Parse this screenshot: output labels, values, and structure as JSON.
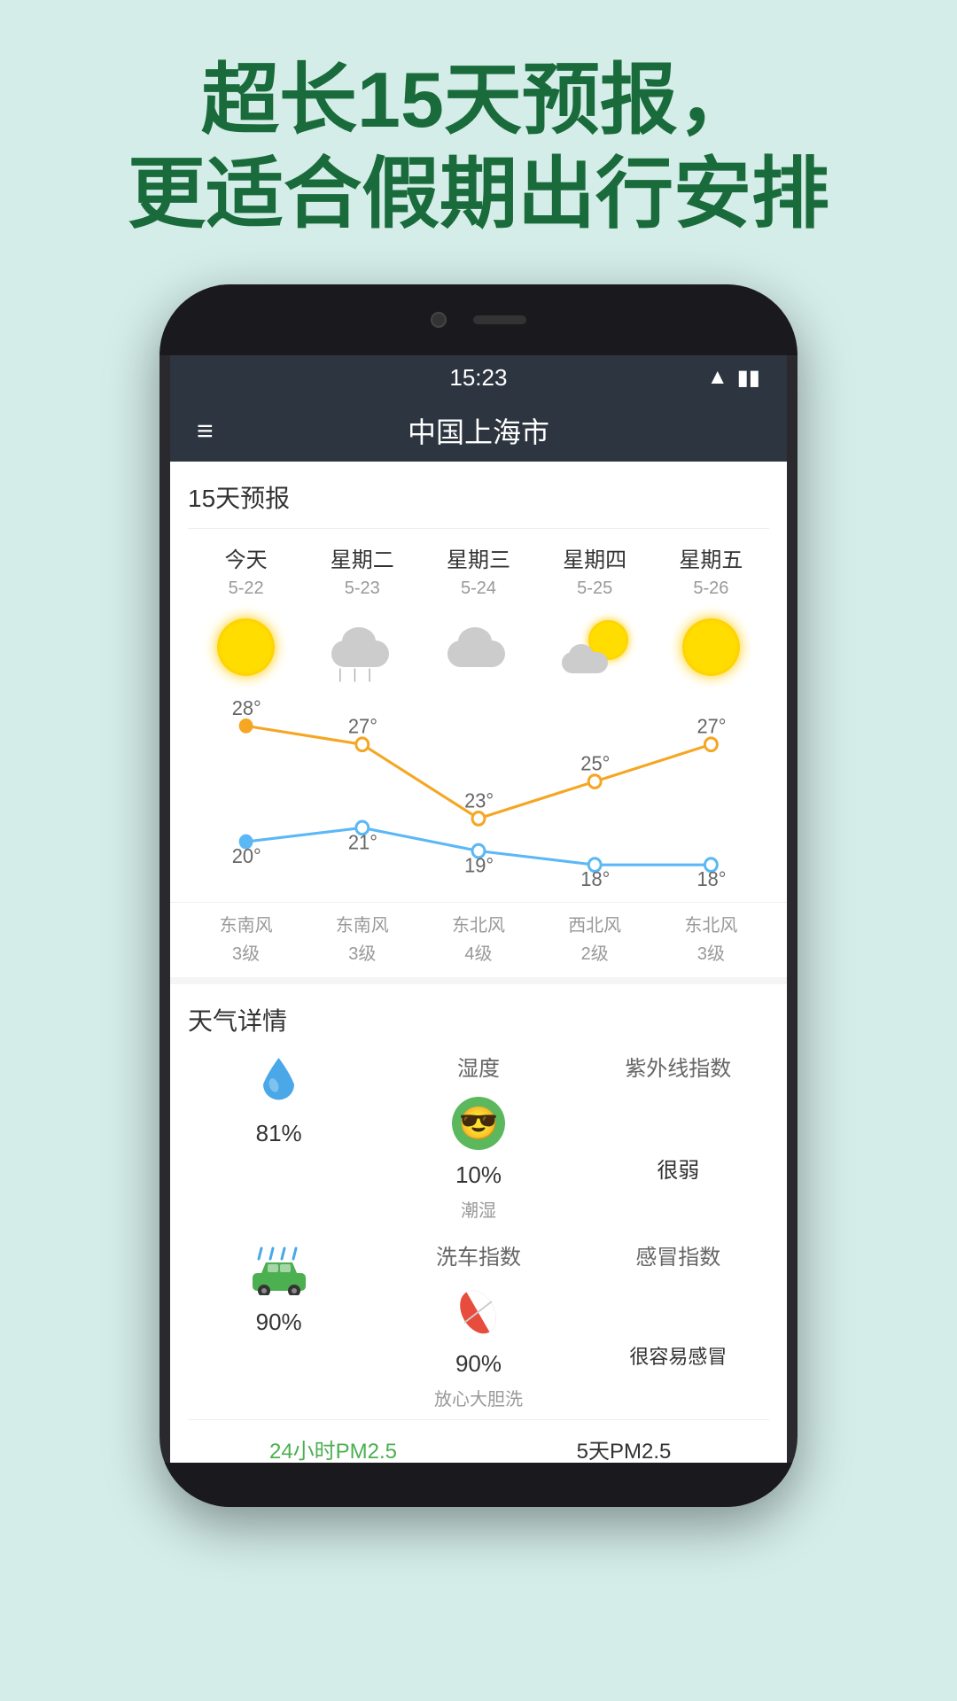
{
  "header": {
    "line1": "超长15天预报，",
    "line2": "更适合假期出行安排"
  },
  "statusBar": {
    "time": "15:23",
    "wifi": "📶",
    "battery": "🔋"
  },
  "appBar": {
    "title": "中国上海市",
    "menuIcon": "≡"
  },
  "forecast": {
    "sectionTitle": "15天预报",
    "days": [
      {
        "name": "今天",
        "date": "5-22",
        "weather": "sunny",
        "high": "28°",
        "low": "20°",
        "wind": "东南风",
        "windLevel": "3级"
      },
      {
        "name": "星期二",
        "date": "5-23",
        "weather": "rainy",
        "high": "27°",
        "low": "21°",
        "wind": "东南风",
        "windLevel": "3级"
      },
      {
        "name": "星期三",
        "date": "5-24",
        "weather": "cloudy",
        "high": "23°",
        "low": "19°",
        "wind": "东北风",
        "windLevel": "4级"
      },
      {
        "name": "星期四",
        "date": "5-25",
        "weather": "partly",
        "high": "25°",
        "low": "18°",
        "wind": "西北风",
        "windLevel": "2级"
      },
      {
        "name": "星期五",
        "date": "5-26",
        "weather": "sunny",
        "high": "27°",
        "low": "18°",
        "wind": "东北风",
        "windLevel": "3级"
      }
    ]
  },
  "details": {
    "sectionTitle": "天气详情",
    "items": [
      {
        "icon": "water",
        "value": "81%",
        "label": "",
        "sublabel": ""
      },
      {
        "icon": "face",
        "value": "10%",
        "label": "湿度",
        "sublabel": "潮湿"
      },
      {
        "icon": "uv",
        "value": "",
        "label": "紫外线指数",
        "sublabel": "很弱"
      },
      {
        "icon": "car",
        "value": "90%",
        "label": "洗车指数",
        "sublabel": "放心大胆洗"
      },
      {
        "icon": "pill",
        "value": "90%",
        "label": "",
        "sublabel": ""
      },
      {
        "icon": "cold",
        "value": "",
        "label": "感冒指数",
        "sublabel": "很容易感冒"
      }
    ]
  },
  "pmTabs": [
    {
      "label": "24小时PM2.5",
      "active": true
    },
    {
      "label": "5天PM2.5",
      "active": false
    }
  ]
}
